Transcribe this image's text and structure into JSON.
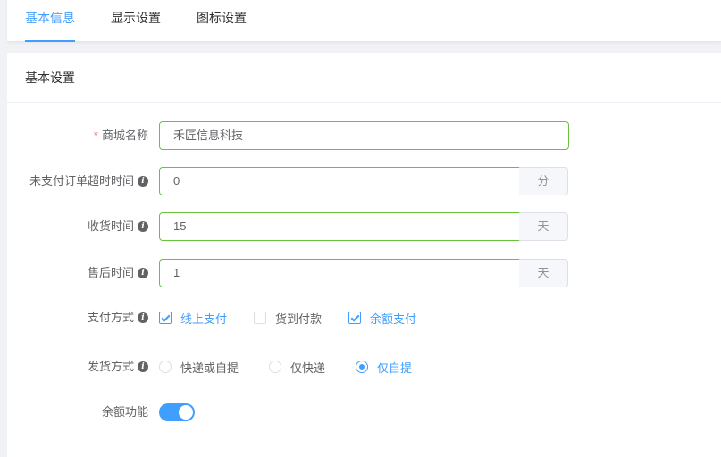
{
  "tabs": [
    {
      "label": "基本信息",
      "active": true
    },
    {
      "label": "显示设置",
      "active": false
    },
    {
      "label": "图标设置",
      "active": false
    }
  ],
  "section_title": "基本设置",
  "form": {
    "shop_name": {
      "label": "商城名称",
      "required_mark": "*",
      "value": "禾匠信息科技"
    },
    "unpaid_timeout": {
      "label": "未支付订单超时时间",
      "value": "0",
      "unit": "分"
    },
    "receive_time": {
      "label": "收货时间",
      "value": "15",
      "unit": "天"
    },
    "after_sale_time": {
      "label": "售后时间",
      "value": "1",
      "unit": "天"
    },
    "payment_method": {
      "label": "支付方式",
      "options": [
        {
          "label": "线上支付",
          "checked": true
        },
        {
          "label": "货到付款",
          "checked": false
        },
        {
          "label": "余额支付",
          "checked": true
        }
      ]
    },
    "delivery_method": {
      "label": "发货方式",
      "options": [
        {
          "label": "快递或自提",
          "selected": false
        },
        {
          "label": "仅快递",
          "selected": false
        },
        {
          "label": "仅自提",
          "selected": true
        }
      ]
    },
    "balance_feature": {
      "label": "余额功能",
      "enabled": true
    }
  },
  "colors": {
    "accent": "#409eff",
    "valid_border": "#67c23a",
    "required": "#f56c6c"
  },
  "icons": {
    "info": "info-circle-icon"
  }
}
